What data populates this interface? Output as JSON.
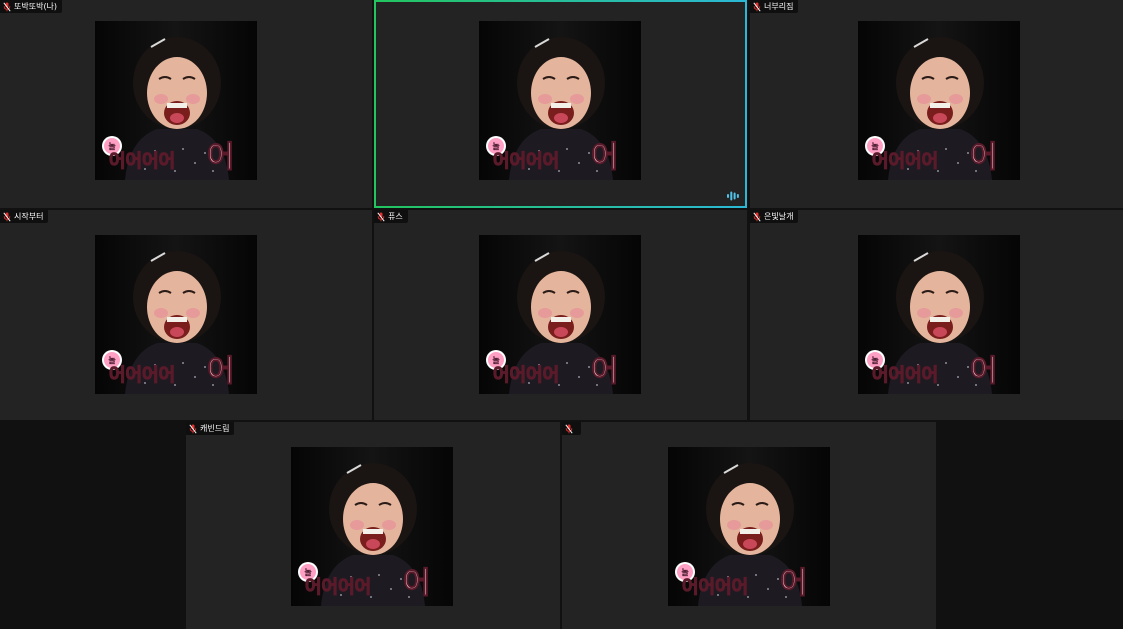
{
  "participants": [
    {
      "name": "또박또박(나)",
      "muted": true,
      "active": false
    },
    {
      "name": "",
      "muted": false,
      "active": true
    },
    {
      "name": "너부리짐",
      "muted": true,
      "active": false
    },
    {
      "name": "시작부터",
      "muted": true,
      "active": false
    },
    {
      "name": "퓨스",
      "muted": true,
      "active": false
    },
    {
      "name": "은빛날개",
      "muted": true,
      "active": false
    },
    {
      "name": "캐빈드림",
      "muted": true,
      "active": false
    },
    {
      "name": "",
      "muted": true,
      "active": false
    }
  ],
  "video_caption": {
    "badge": "깜놀",
    "text": "어어어어어"
  },
  "colors": {
    "mic_muted": "#e0312f",
    "active_border": "#22c55e",
    "speaking_indicator": "#4fc3e8"
  },
  "icons": {
    "muted": "mic-off-icon",
    "speaking": "audio-level-icon"
  }
}
